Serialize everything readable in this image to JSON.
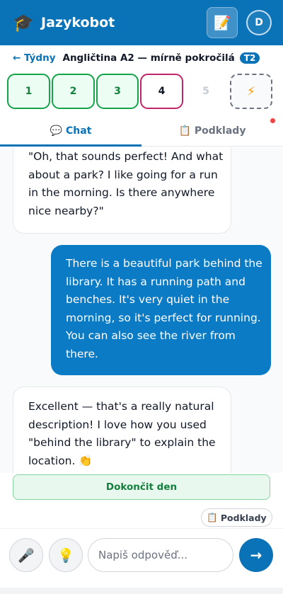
{
  "header": {
    "logo_glyph": "🎓",
    "title": "Jazykobot",
    "notes_icon_glyph": "📝",
    "avatar_initial": "D"
  },
  "breadcrumb": {
    "back_label": "← Týdny",
    "course": "Angličtina A2 — mírně pokročilá",
    "level_badge": "T2"
  },
  "days": [
    {
      "label": "1",
      "state": "done"
    },
    {
      "label": "2",
      "state": "done"
    },
    {
      "label": "3",
      "state": "done"
    },
    {
      "label": "4",
      "state": "current"
    },
    {
      "label": "5",
      "state": "locked"
    },
    {
      "label": "⚡",
      "state": "bonus"
    }
  ],
  "tabs": [
    {
      "icon": "💬",
      "label": "Chat"
    },
    {
      "icon": "📋",
      "label": "Podklady"
    }
  ],
  "messages": [
    {
      "role": "bot",
      "lines": [
        "\"Oh, that sounds perfect! And what",
        "about a park? I like going for a run",
        "in the morning. Is there anywhere",
        "nice nearby?\""
      ]
    },
    {
      "role": "user",
      "lines": [
        "There is a beautiful park behind the",
        "library. It has a running path and",
        "benches. It's very quiet in the",
        "morning, so it's perfect for running.",
        "You can also see the river from",
        "there."
      ]
    },
    {
      "role": "bot",
      "lines": [
        "Excellent — that's a really natural",
        "description! I love how you used",
        "\"behind the library\" to explain the",
        "location. 👏"
      ]
    }
  ],
  "finish_day_label": "Dokončit den",
  "podklady_chip": {
    "icon": "📋",
    "label": "Podklady"
  },
  "composer": {
    "mic_glyph": "🎤",
    "hint_glyph": "💡",
    "placeholder": "Napiš odpověď...",
    "send_glyph": "→"
  },
  "colors": {
    "brand": "#0a73b8",
    "done_green": "#16a34a",
    "current_pink": "#c02667",
    "notification_red": "#ef4444"
  }
}
